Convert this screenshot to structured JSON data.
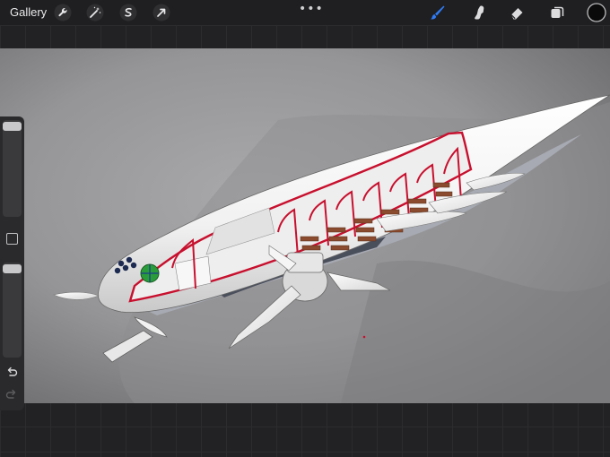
{
  "app": {
    "gallery_label": "Gallery"
  },
  "toolbar": {
    "more_glyph": "•••",
    "tools_left": [
      "wrench-icon",
      "magic-wand-icon",
      "selection-icon",
      "transform-arrow-icon"
    ],
    "tools_right": [
      "brush-icon",
      "smudge-icon",
      "eraser-icon",
      "layers-icon",
      "color-swatch"
    ],
    "active_tool": "brush-icon",
    "active_color": "#0a0a0a",
    "accent_color": "#2f7bf5"
  },
  "sidebar": {
    "brush_size_level": 0.97,
    "opacity_level": 0.97,
    "controls": [
      "modify-button",
      "undo-button",
      "redo-button"
    ]
  }
}
